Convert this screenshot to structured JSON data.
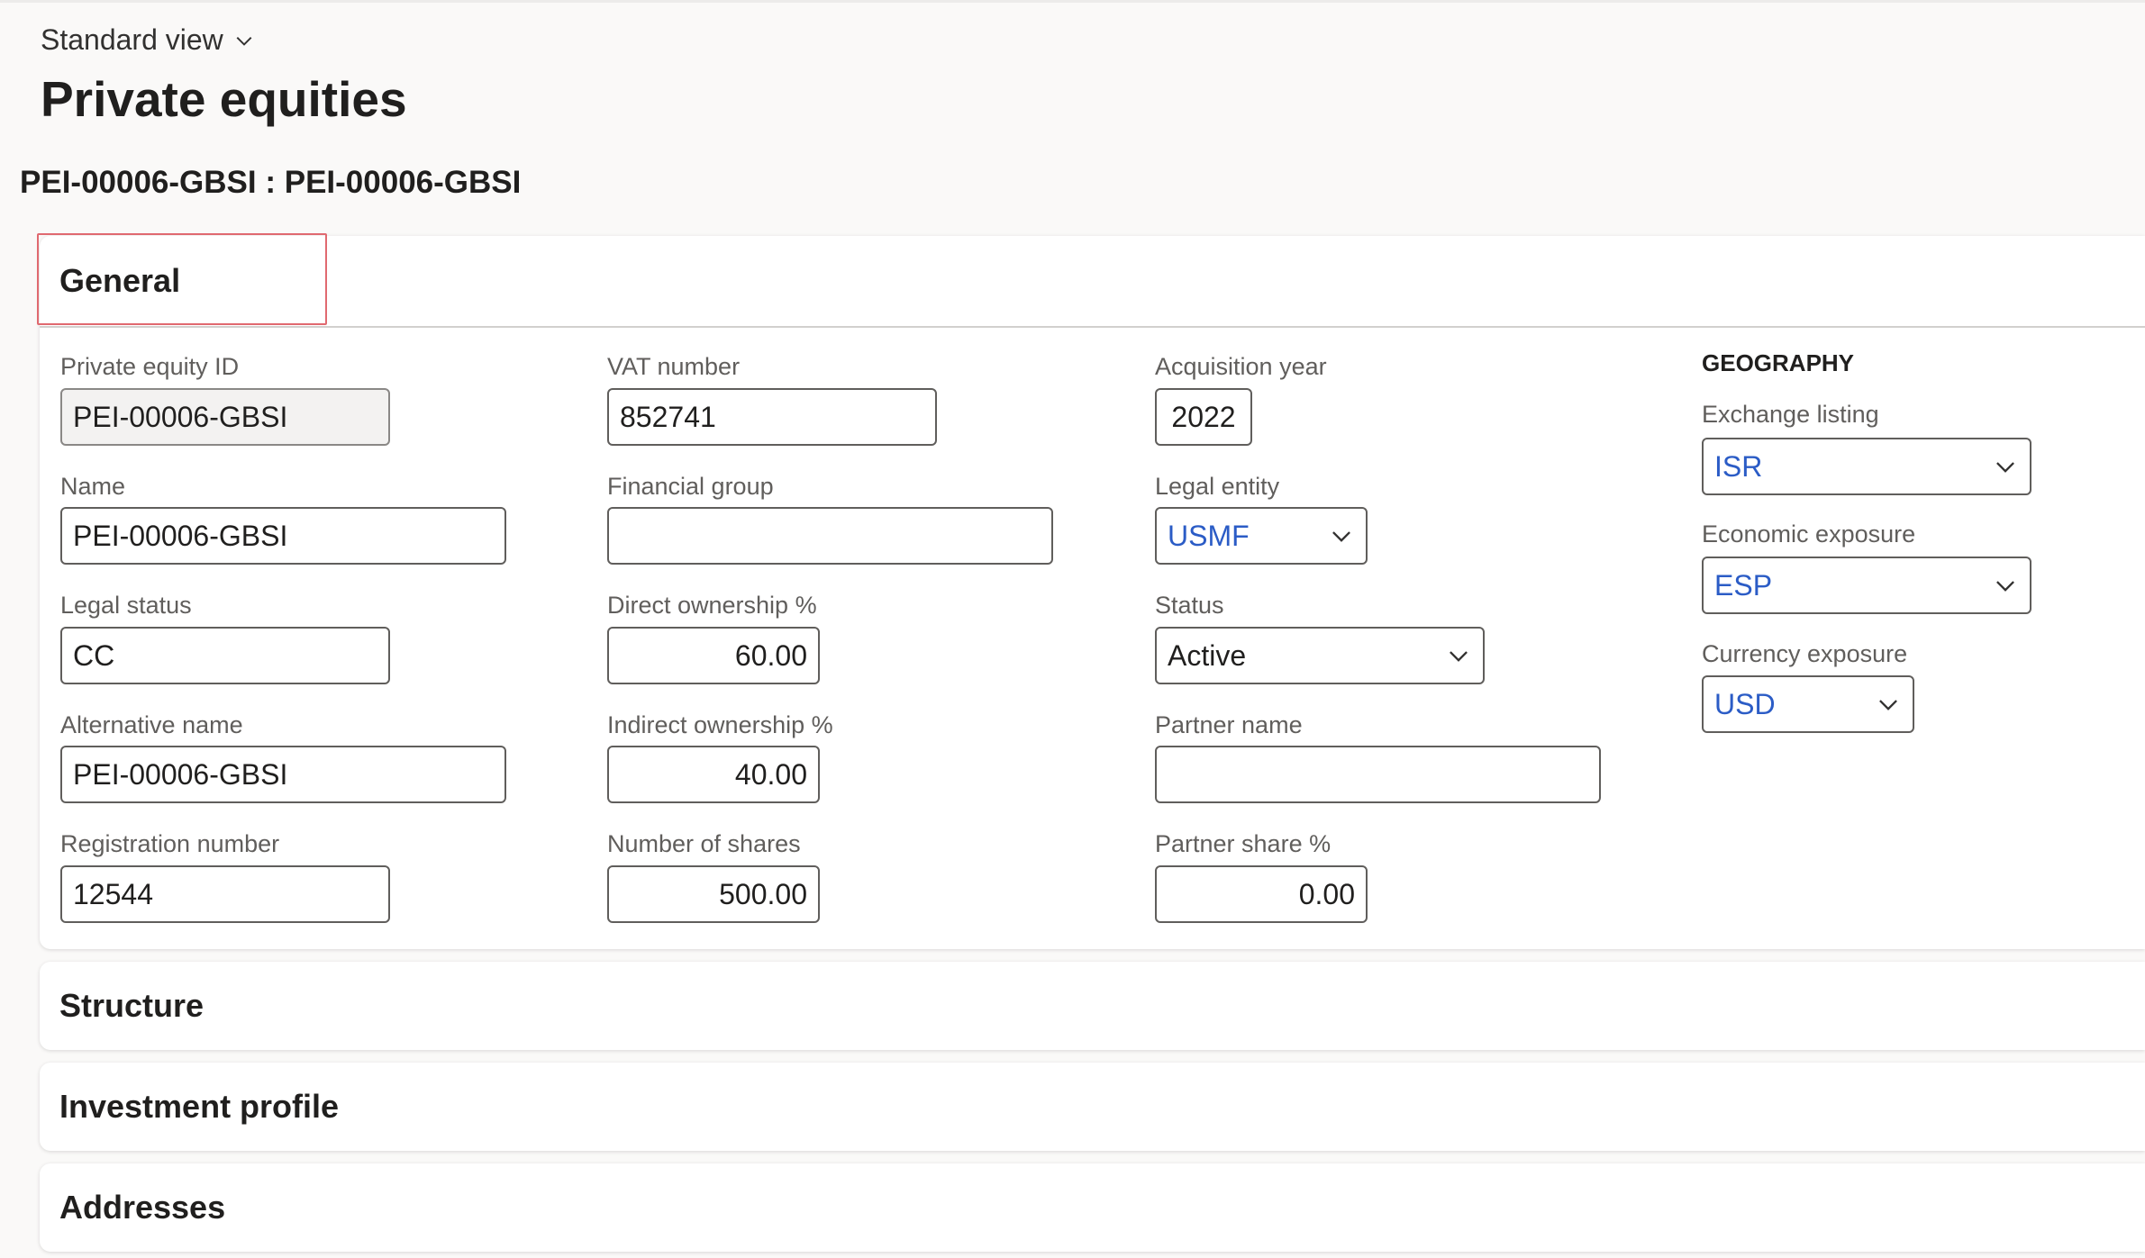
{
  "header": {
    "view_label": "Standard view",
    "page_title": "Private equities",
    "record_title": "PEI-00006-GBSI : PEI-00006-GBSI"
  },
  "tabs": {
    "general": "General",
    "structure": "Structure",
    "investment_profile": "Investment profile",
    "addresses": "Addresses"
  },
  "general": {
    "private_equity_id": {
      "label": "Private equity ID",
      "value": "PEI-00006-GBSI"
    },
    "name": {
      "label": "Name",
      "value": "PEI-00006-GBSI"
    },
    "legal_status": {
      "label": "Legal status",
      "value": "CC"
    },
    "alternative_name": {
      "label": "Alternative name",
      "value": "PEI-00006-GBSI"
    },
    "registration_number": {
      "label": "Registration number",
      "value": "12544"
    },
    "vat_number": {
      "label": "VAT number",
      "value": "852741"
    },
    "financial_group": {
      "label": "Financial group",
      "value": ""
    },
    "direct_ownership": {
      "label": "Direct ownership %",
      "value": "60.00"
    },
    "indirect_ownership": {
      "label": "Indirect ownership %",
      "value": "40.00"
    },
    "number_of_shares": {
      "label": "Number of shares",
      "value": "500.00"
    },
    "acquisition_year": {
      "label": "Acquisition year",
      "value": "2022"
    },
    "legal_entity": {
      "label": "Legal entity",
      "value": "USMF"
    },
    "status": {
      "label": "Status",
      "value": "Active"
    },
    "partner_name": {
      "label": "Partner name",
      "value": ""
    },
    "partner_share": {
      "label": "Partner share %",
      "value": "0.00"
    }
  },
  "geography": {
    "heading": "GEOGRAPHY",
    "exchange_listing": {
      "label": "Exchange listing",
      "value": "ISR"
    },
    "economic_exposure": {
      "label": "Economic exposure",
      "value": "ESP"
    },
    "currency_exposure": {
      "label": "Currency exposure",
      "value": "USD"
    }
  },
  "colors": {
    "lookup_link": "#2b5cc6",
    "focus_outline": "#e06970",
    "background": "#faf9f8"
  },
  "icons": {
    "view_toggle": "chevron-down-icon",
    "dropdown": "chevron-down-icon"
  }
}
